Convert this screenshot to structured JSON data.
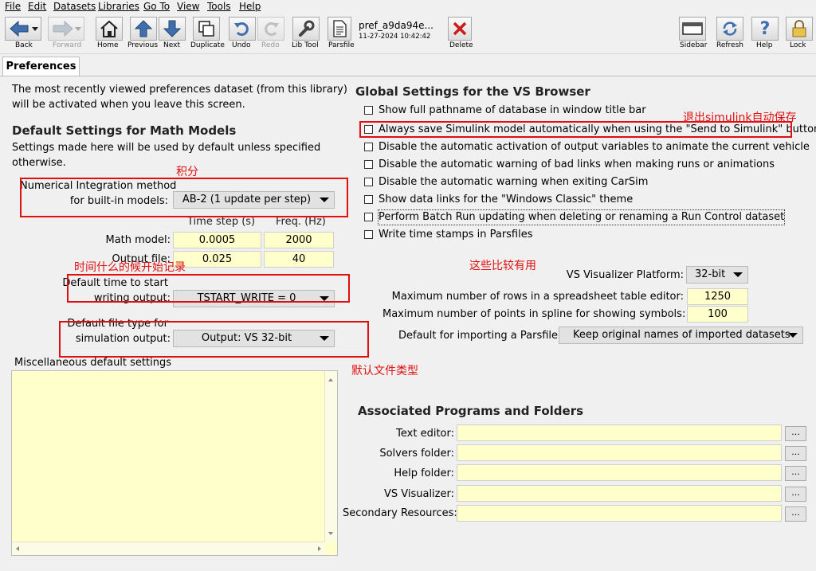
{
  "menu": [
    "File",
    "Edit",
    "Datasets",
    "Libraries",
    "Go To",
    "View",
    "Tools",
    "Help"
  ],
  "toolbar": {
    "back": "Back",
    "forward": "Forward",
    "home": "Home",
    "previous": "Previous",
    "next": "Next",
    "duplicate": "Duplicate",
    "undo": "Undo",
    "redo": "Redo",
    "lib_tool": "Lib Tool",
    "parsfile": "Parsfile",
    "dataset_name": "pref_a9da94e...",
    "dataset_date": "11-27-2024 10:42:42",
    "delete": "Delete",
    "sidebar": "Sidebar",
    "refresh": "Refresh",
    "help": "Help",
    "lock": "Lock"
  },
  "tab": "Preferences",
  "left": {
    "intro1": "The most recently viewed preferences dataset (from this library)",
    "intro2": "will be activated when you leave this screen.",
    "math_header": "Default Settings for Math Models",
    "math_desc1": "Settings made here will be used by default unless specified",
    "math_desc2": "otherwise.",
    "integ_label1": "Numerical Integration method",
    "integ_label2": "for built-in models:",
    "integ_value": "AB-2 (1 update per step)",
    "col_time": "Time step (s)",
    "col_freq": "Freq. (Hz)",
    "math_model_label": "Math model:",
    "math_model_step": "0.0005",
    "math_model_freq": "2000",
    "output_file_label": "Output file:",
    "output_file_step": "0.025",
    "output_file_freq": "40",
    "start_label1": "Default time to start",
    "start_label2": "writing output:",
    "start_value": "TSTART_WRITE = 0",
    "filetype_label1": "Default file type for",
    "filetype_label2": "simulation output:",
    "filetype_value": "Output: VS 32-bit",
    "misc_label": "Miscellaneous default settings"
  },
  "right": {
    "global_header": "Global Settings for the VS Browser",
    "checkboxes": [
      "Show full pathname of database in window title bar",
      "Always save Simulink model automatically when using the \"Send to Simulink\" button",
      "Disable the automatic activation of output variables to animate the current vehicle",
      "Disable the automatic warning of bad links when making runs or animations",
      "Disable the automatic warning when exiting CarSim",
      "Show data links for the \"Windows Classic\" theme",
      "Perform Batch Run updating when deleting or renaming a Run Control dataset",
      "Write time stamps in Parsfiles"
    ],
    "platform_label": "VS Visualizer Platform:",
    "platform_value": "32-bit",
    "rows_label": "Maximum number of rows in a spreadsheet table editor:",
    "rows_value": "1250",
    "points_label": "Maximum number of points in spline for showing symbols:",
    "points_value": "100",
    "import_label": "Default for importing a Parsfile:",
    "import_value": "Keep original names of imported datasets",
    "assoc_header": "Associated Programs and Folders",
    "assoc_items": [
      "Text editor:",
      "Solvers folder:",
      "Help folder:",
      "VS Visualizer:",
      "Secondary Resources:"
    ],
    "browse": "..."
  },
  "annotations": {
    "integration": "积分",
    "start_time": "时间什么的候开始记录",
    "file_type": "默认文件类型",
    "useful": "这些比较有用",
    "simulink": "退出simulink自动保存"
  },
  "colors": {
    "field_yellow": "#ffffcc",
    "annotation_red": "#e01010"
  }
}
